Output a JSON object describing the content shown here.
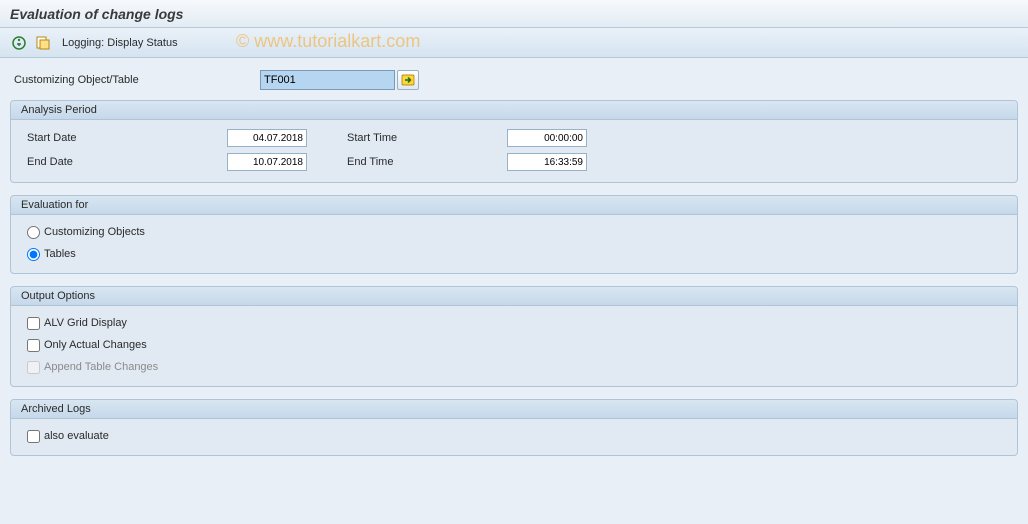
{
  "header": {
    "title": "Evaluation of change logs"
  },
  "toolbar": {
    "logging_label": "Logging: Display Status"
  },
  "watermark": "© www.tutorialkart.com",
  "main": {
    "object_table_label": "Customizing Object/Table",
    "object_table_value": "TF001"
  },
  "analysis_period": {
    "title": "Analysis Period",
    "start_date_label": "Start Date",
    "start_date_value": "04.07.2018",
    "end_date_label": "End Date",
    "end_date_value": "10.07.2018",
    "start_time_label": "Start Time",
    "start_time_value": "00:00:00",
    "end_time_label": "End Time",
    "end_time_value": "16:33:59"
  },
  "evaluation_for": {
    "title": "Evaluation for",
    "option_customizing": "Customizing Objects",
    "option_tables": "Tables"
  },
  "output_options": {
    "title": "Output Options",
    "alv_grid": "ALV Grid Display",
    "only_actual": "Only Actual Changes",
    "append_table": "Append Table Changes"
  },
  "archived_logs": {
    "title": "Archived Logs",
    "also_evaluate": "also evaluate"
  }
}
